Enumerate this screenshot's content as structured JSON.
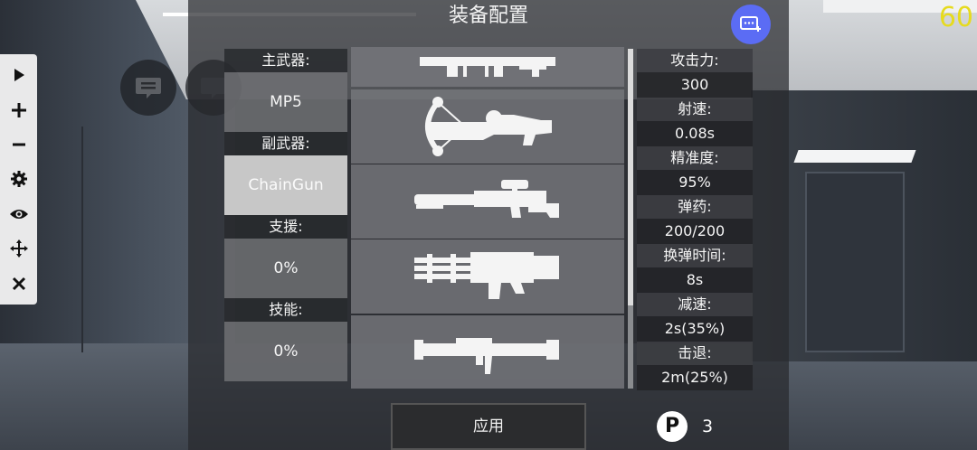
{
  "title": "装备配置",
  "fps": "60",
  "slots": [
    {
      "label": "主武器:",
      "value": "MP5",
      "selected": false
    },
    {
      "label": "副武器:",
      "value": "ChainGun",
      "selected": true
    },
    {
      "label": "支援:",
      "value": "0%",
      "selected": false
    },
    {
      "label": "技能:",
      "value": "0%",
      "selected": false
    }
  ],
  "weapons": [
    {
      "icon": "rifle-icon"
    },
    {
      "icon": "crossbow-icon"
    },
    {
      "icon": "sniper-rifle-icon"
    },
    {
      "icon": "minigun-icon"
    },
    {
      "icon": "rocket-launcher-icon"
    }
  ],
  "stats": [
    {
      "label": "攻击力:",
      "value": "300"
    },
    {
      "label": "射速:",
      "value": "0.08s"
    },
    {
      "label": "精准度:",
      "value": "95%"
    },
    {
      "label": "弹药:",
      "value": "200/200"
    },
    {
      "label": "换弹时间:",
      "value": "8s"
    },
    {
      "label": "减速:",
      "value": "2s(35%)"
    },
    {
      "label": "击退:",
      "value": "2m(25%)"
    }
  ],
  "apply_label": "应用",
  "points": {
    "icon_letter": "P",
    "count": "3"
  },
  "toolbar": [
    "play-icon",
    "plus-icon",
    "minus-icon",
    "gear-icon",
    "eye-icon",
    "move-icon",
    "close-icon"
  ],
  "colors": {
    "fab": "#5b6cf4",
    "fps": "#e6db1e",
    "selected_slot": "#c7c7c7"
  }
}
